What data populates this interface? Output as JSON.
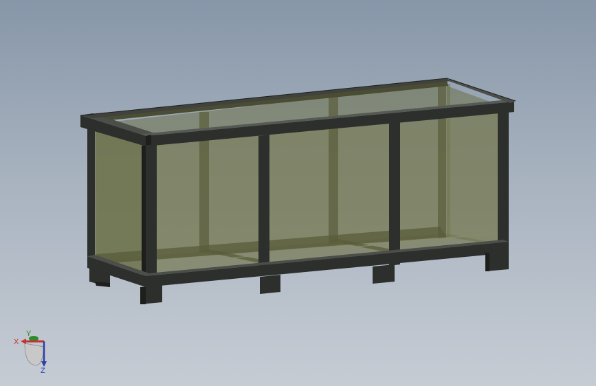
{
  "viewport": {
    "background_top": "#8796a8",
    "background_bottom": "#c6ccd4"
  },
  "model": {
    "name": "",
    "frame_color": "#2d2f2c",
    "glass_color": "#6b6f47"
  },
  "triad": {
    "x_label": "X",
    "y_label": "Y",
    "z_label": "Z",
    "x_color": "#c8322d",
    "y_color": "#2e8b2e",
    "z_color": "#2a3fa8"
  }
}
